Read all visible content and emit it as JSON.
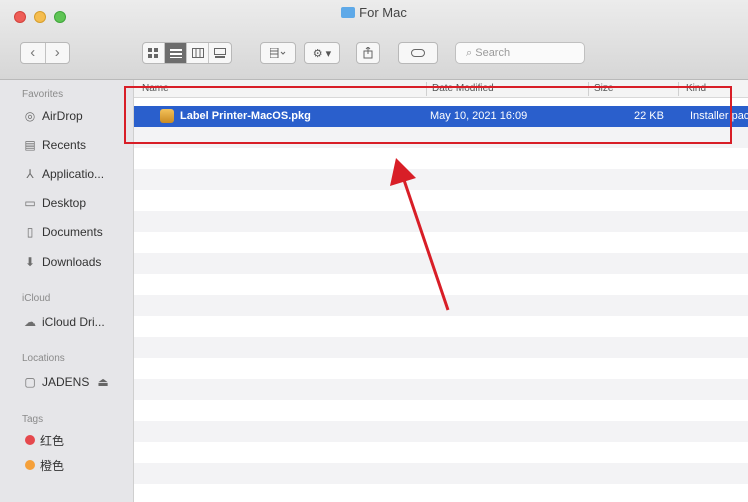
{
  "window": {
    "title": "For Mac"
  },
  "toolbar": {
    "back": "‹",
    "forward": "›",
    "search_placeholder": "Search"
  },
  "sidebar": {
    "favorites_header": "Favorites",
    "favorites": [
      {
        "label": "AirDrop",
        "icon": "airdrop-icon"
      },
      {
        "label": "Recents",
        "icon": "recents-icon"
      },
      {
        "label": "Applicatio...",
        "icon": "applications-icon"
      },
      {
        "label": "Desktop",
        "icon": "desktop-icon"
      },
      {
        "label": "Documents",
        "icon": "documents-icon"
      },
      {
        "label": "Downloads",
        "icon": "downloads-icon"
      }
    ],
    "icloud_header": "iCloud",
    "icloud": [
      {
        "label": "iCloud Dri...",
        "icon": "icloud-icon"
      }
    ],
    "locations_header": "Locations",
    "locations": [
      {
        "label": "JADENS",
        "icon": "disk-icon",
        "eject": "⏏"
      }
    ],
    "tags_header": "Tags",
    "tags": [
      {
        "label": "红色",
        "color": "#e5484d"
      },
      {
        "label": "橙色",
        "color": "#f5a03a"
      }
    ]
  },
  "columns": {
    "name": "Name",
    "date": "Date Modified",
    "size": "Size",
    "kind": "Kind"
  },
  "files": [
    {
      "name": "Label Printer-MacOS.pkg",
      "date": "May 10, 2021 16:09",
      "size": "22 KB",
      "kind": "Installer pac",
      "icon": "package-icon",
      "selected": true
    }
  ],
  "colors": {
    "selection": "#2a5fcc",
    "annotation": "#d81e27"
  }
}
